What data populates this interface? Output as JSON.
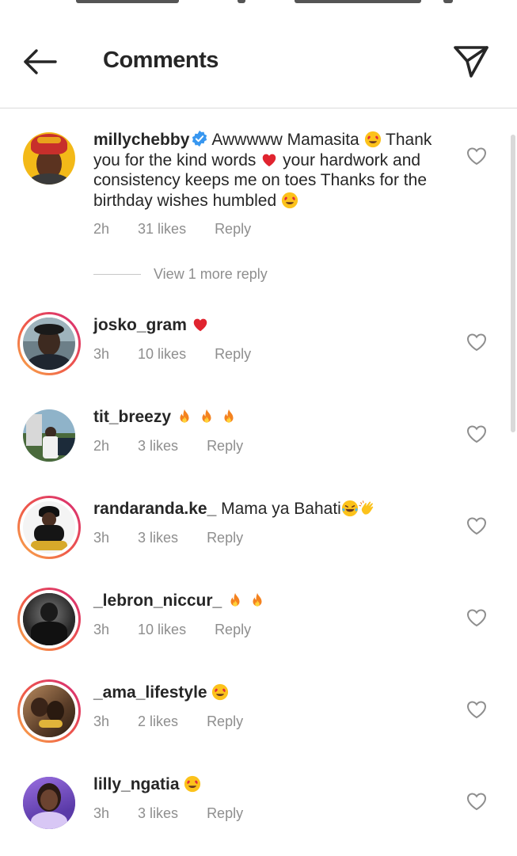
{
  "header": {
    "title": "Comments",
    "back_icon": "arrow-left-icon",
    "send_icon": "paper-plane-icon"
  },
  "comments": [
    {
      "username": "millychebby",
      "verified": true,
      "text_parts": [
        "Awwwww Mamasita",
        "Thank you for the kind words",
        "your hardwork and consistency keeps me on toes Thanks for the birthday wishes humbled"
      ],
      "time": "2h",
      "likes": "31 likes",
      "reply": "Reply",
      "story_ring": false
    },
    {
      "username": "josko_gram",
      "text_parts": [
        ""
      ],
      "time": "3h",
      "likes": "10 likes",
      "reply": "Reply",
      "story_ring": true
    },
    {
      "username": "tit_breezy",
      "text_parts": [
        ""
      ],
      "time": "2h",
      "likes": "3 likes",
      "reply": "Reply",
      "story_ring": false
    },
    {
      "username": "randaranda.ke_",
      "text_parts": [
        "Mama ya Bahati"
      ],
      "time": "3h",
      "likes": "3 likes",
      "reply": "Reply",
      "story_ring": true
    },
    {
      "username": "_lebron_niccur_",
      "text_parts": [
        ""
      ],
      "time": "3h",
      "likes": "10 likes",
      "reply": "Reply",
      "story_ring": true
    },
    {
      "username": "_ama_lifestyle",
      "text_parts": [
        ""
      ],
      "time": "3h",
      "likes": "2 likes",
      "reply": "Reply",
      "story_ring": true
    },
    {
      "username": "lilly_ngatia",
      "text_parts": [
        ""
      ],
      "time": "3h",
      "likes": "3 likes",
      "reply": "Reply",
      "story_ring": false
    }
  ],
  "view_more_replies": "View 1 more reply",
  "colors": {
    "text": "#262626",
    "secondary": "#8e8e8e",
    "verified": "#3897f0",
    "heart_red": "#e0242f",
    "divider": "#dbdbdb"
  }
}
